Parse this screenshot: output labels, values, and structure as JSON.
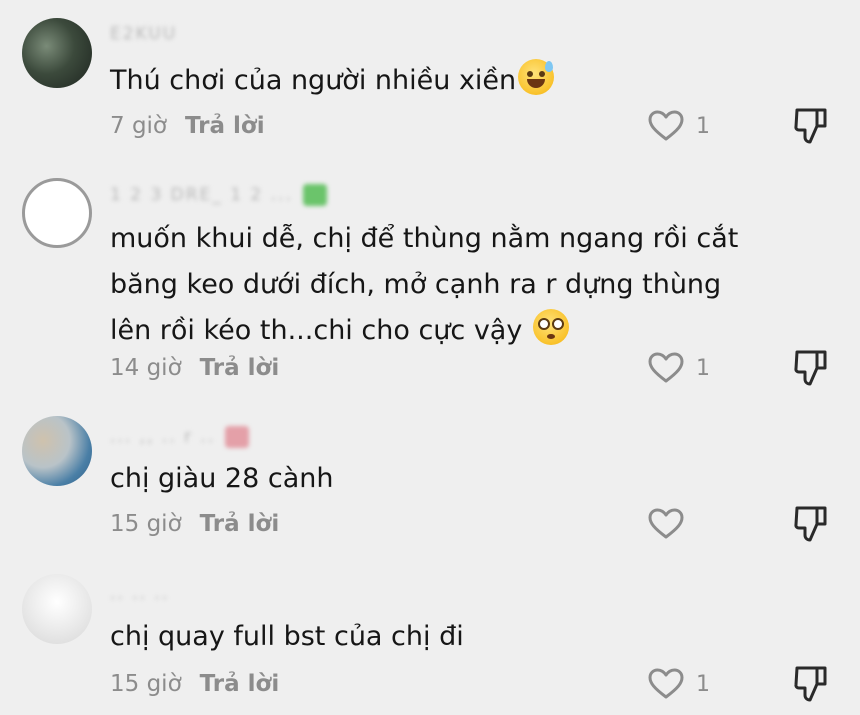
{
  "comments": [
    {
      "username": "E2KUU",
      "text_lines": [
        "Thú chơi của người nhiều xiền"
      ],
      "emoji": "sweat-smile-emoji",
      "time": "7 giờ",
      "reply_label": "Trả lời",
      "likes": "1"
    },
    {
      "username": "1 2 3 DRE_ 1 2 ...",
      "text_lines": [
        "muốn khui dễ, chị để thùng nằm ngang rồi cắt",
        "băng keo dưới đích, mở cạnh ra r dựng thùng",
        "lên rồi kéo th...chi cho cực vậy"
      ],
      "emoji": "flushed-face-emoji",
      "time": "14 giờ",
      "reply_label": "Trả lời",
      "likes": "1"
    },
    {
      "username": "...  ,, .. r ..",
      "text_lines": [
        "chị giàu 28 cành"
      ],
      "emoji": "",
      "time": "15 giờ",
      "reply_label": "Trả lời",
      "likes": ""
    },
    {
      "username": "..  ..  ..",
      "text_lines": [
        "chị quay full bst của chị đi"
      ],
      "emoji": "",
      "time": "15 giờ",
      "reply_label": "Trả lời",
      "likes": "1"
    }
  ]
}
